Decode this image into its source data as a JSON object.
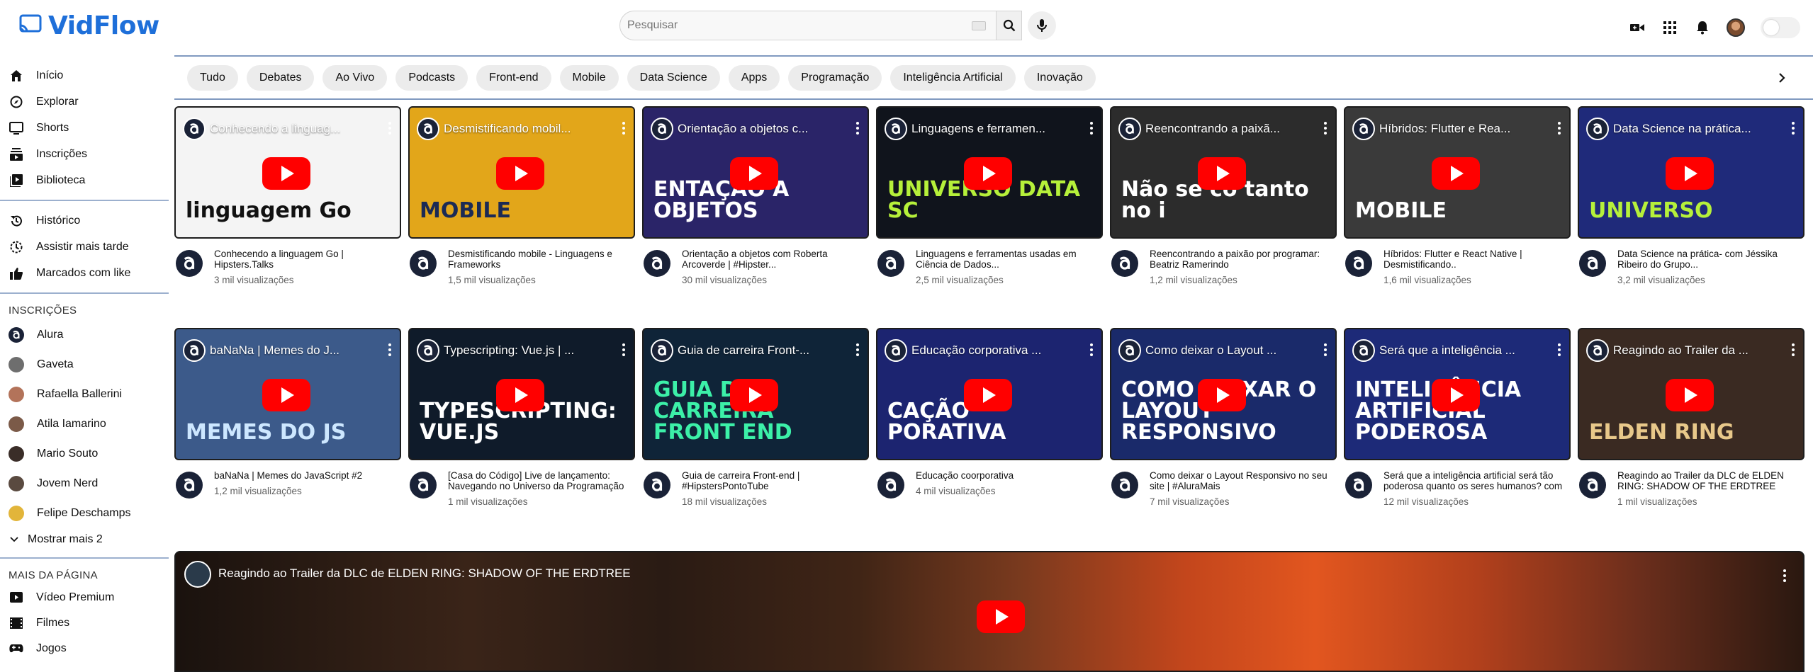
{
  "brand": {
    "name": "VidFlow",
    "color": "#1e6fd9"
  },
  "search": {
    "placeholder": "Pesquisar"
  },
  "header_icons": [
    "video-camera-icon",
    "apps-grid-icon",
    "bell-icon",
    "avatar",
    "theme-toggle"
  ],
  "sidebar": {
    "main": [
      {
        "label": "Início",
        "icon": "home-icon"
      },
      {
        "label": "Explorar",
        "icon": "compass-icon"
      },
      {
        "label": "Shorts",
        "icon": "shorts-icon"
      },
      {
        "label": "Inscrições",
        "icon": "subscriptions-icon"
      },
      {
        "label": "Biblioteca",
        "icon": "library-icon"
      }
    ],
    "library": [
      {
        "label": "Histórico",
        "icon": "history-icon"
      },
      {
        "label": "Assistir mais tarde",
        "icon": "clock-icon"
      },
      {
        "label": "Marcados com like",
        "icon": "thumbs-up-icon"
      }
    ],
    "subscriptions_heading": "INSCRIÇÕES",
    "subscriptions": [
      {
        "label": "Alura",
        "color": "#1a2237"
      },
      {
        "label": "Gaveta",
        "color": "#6e6e6e"
      },
      {
        "label": "Rafaella Ballerini",
        "color": "#b3735a"
      },
      {
        "label": "Atila Iamarino",
        "color": "#7b5a48"
      },
      {
        "label": "Mario Souto",
        "color": "#3a2d28"
      },
      {
        "label": "Jovem Nerd",
        "color": "#5a4a40"
      },
      {
        "label": "Felipe Deschamps",
        "color": "#e2b53a"
      }
    ],
    "show_more": "Mostrar mais 2",
    "more_heading": "MAIS DA PÁGINA",
    "more": [
      {
        "label": "Vídeo Premium",
        "icon": "premium-play-icon"
      },
      {
        "label": "Filmes",
        "icon": "film-icon"
      },
      {
        "label": "Jogos",
        "icon": "gamepad-icon"
      }
    ]
  },
  "chips": [
    "Tudo",
    "Debates",
    "Ao Vivo",
    "Podcasts",
    "Front-end",
    "Mobile",
    "Data Science",
    "Apps",
    "Programação",
    "Inteligência Artificial",
    "Inovação"
  ],
  "videos_row1": [
    {
      "overlay": "Conhecendo a linguag...",
      "title": "Conhecendo a linguagem Go | Hipsters.Talks",
      "views": "3 mil visualizações",
      "bg": "#f4f4f4",
      "big": "linguagem Go",
      "big_color": "#111111"
    },
    {
      "overlay": "Desmistificando mobil...",
      "title": "Desmistificando mobile - Linguagens e Frameworks",
      "views": "1,5 mil visualizações",
      "bg": "#e2a61a",
      "big": "MOBILE",
      "big_color": "#1b2a55"
    },
    {
      "overlay": "Orientação a objetos c...",
      "title": "Orientação a objetos com Roberta Arcoverde | #Hipster...",
      "views": "30 mil visualizações",
      "bg": "#2a2468",
      "big": "ENTAÇÃO A OBJETOS",
      "big_color": "#ffffff"
    },
    {
      "overlay": "Linguagens e ferramen...",
      "title": "Linguagens e ferramentas usadas em Ciência de Dados...",
      "views": "2,5 mil visualizações",
      "bg": "#10141c",
      "big": "UNIVERSO DATA SC",
      "big_color": "#b6f03a"
    },
    {
      "overlay": "Reencontrando a paixã...",
      "title": "Reencontrando a paixão por programar: Beatriz Ramerindo",
      "views": "1,2 mil visualizações",
      "bg": "#2c2c2c",
      "big": "Não se co tanto no i",
      "big_color": "#ffffff"
    },
    {
      "overlay": "Híbridos: Flutter e Rea...",
      "title": "Híbridos: Flutter e React Native | Desmistificando..",
      "views": "1,6 mil visualizações",
      "bg": "#3a3a3a",
      "big": "MOBILE",
      "big_color": "#ffffff"
    },
    {
      "overlay": "Data Science na prática...",
      "title": "Data Science na prática- com Jéssika Ribeiro do Grupo...",
      "views": "3,2 mil visualizações",
      "bg": "#1f2a7a",
      "big": "UNIVERSO",
      "big_color": "#b6f03a"
    }
  ],
  "videos_row2": [
    {
      "overlay": "baNaNa | Memes do J...",
      "title": "baNaNa | Memes do JavaScript #2",
      "views": "1,2 mil visualizações",
      "bg": "#3c5a8a",
      "big": "MEMES DO JS",
      "big_color": "#cde7ff"
    },
    {
      "overlay": "Typescripting: Vue.js | ...",
      "title": "[Casa do Código] Live de lançamento: Navegando no Universo da Programação",
      "views": "1 mil visualizações",
      "bg": "#0f1b2a",
      "big": "TYPESCRIPTING: VUE.JS",
      "big_color": "#ffffff"
    },
    {
      "overlay": "Guia de carreira Front-...",
      "title": "Guia de carreira Front-end | #HipstersPontoTube",
      "views": "18 mil visualizações",
      "bg": "#0f2438",
      "big": "GUIA DE CARREIRA FRONT END",
      "big_color": "#3cf0a8"
    },
    {
      "overlay": "Educação corporativa ...",
      "title": "Educação coorporativa",
      "views": "4 mil visualizações",
      "bg": "#1c2470",
      "big": "CAÇÃO PORATIVA",
      "big_color": "#ffffff"
    },
    {
      "overlay": "Como deixar o Layout ...",
      "title": "Como deixar o Layout Responsivo no seu site | #AluraMais",
      "views": "7 mil visualizações",
      "bg": "#1a2a6a",
      "big": "COMO DEIXAR O LAYOUT RESPONSIVO",
      "big_color": "#ffffff"
    },
    {
      "overlay": "Será que a inteligência ...",
      "title": "Será que a inteligência artificial será tão poderosa quanto os seres humanos? com Gui Silveira",
      "views": "12 mil visualizações",
      "bg": "#1d2a78",
      "big": "INTELIGÊNCIA ARTIFICIAL PODEROSA",
      "big_color": "#ffffff"
    },
    {
      "overlay": "Reagindo ao Trailer da ...",
      "title": "Reagindo ao Trailer da DLC de ELDEN RING: SHADOW OF THE ERDTREE",
      "views": "1 mil visualizações",
      "bg": "#3a2a22",
      "big": "ELDEN RING",
      "big_color": "#e8c88a"
    }
  ],
  "featured": {
    "title": "Reagindo ao Trailer da DLC de ELDEN RING: SHADOW OF THE ERDTREE"
  }
}
